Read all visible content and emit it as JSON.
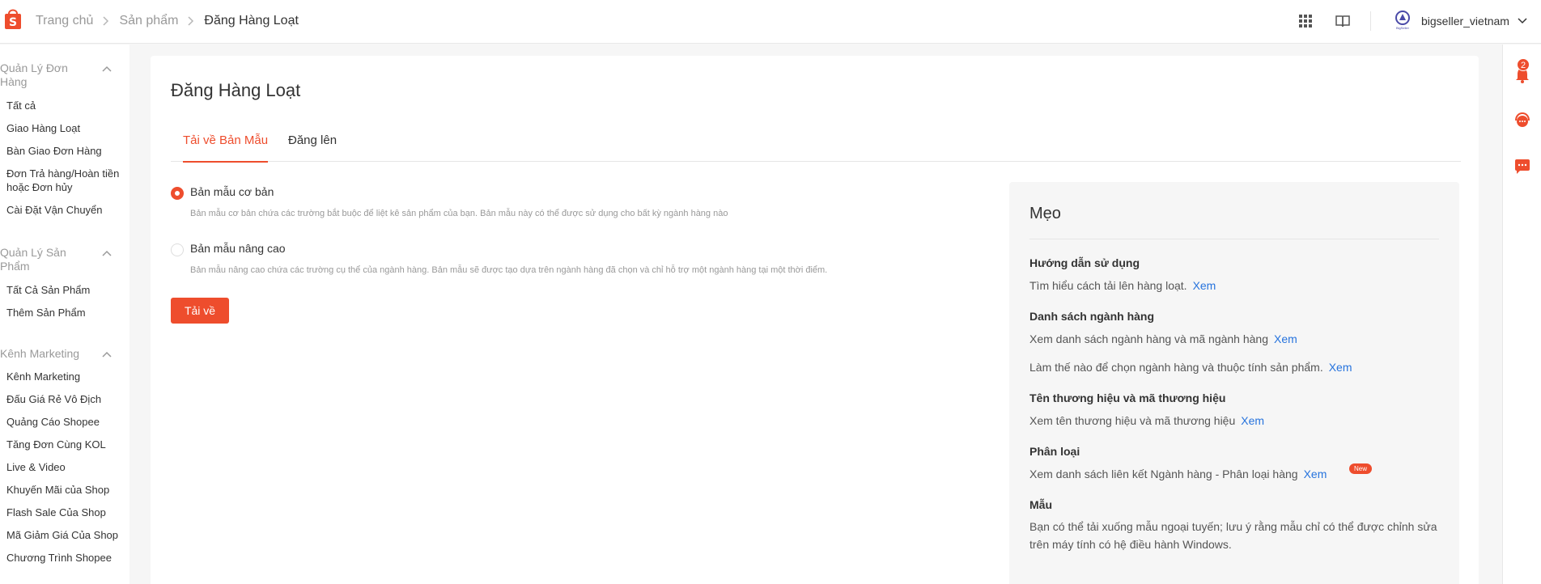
{
  "header": {
    "breadcrumb": [
      "Trang chủ",
      "Sản phẩm",
      "Đăng Hàng Loạt"
    ],
    "username": "bigseller_vietnam",
    "user_logo_caption": "BigSeller"
  },
  "sidebar": {
    "groups": [
      {
        "title": "Quản Lý Đơn Hàng",
        "items": [
          "Tất cả",
          "Giao Hàng Loạt",
          "Bàn Giao Đơn Hàng",
          "Đơn Trả hàng/Hoàn tiền hoặc Đơn hủy",
          "Cài Đặt Vận Chuyển"
        ]
      },
      {
        "title": "Quản Lý Sản Phẩm",
        "items": [
          "Tất Cả Sản Phẩm",
          "Thêm Sản Phẩm"
        ]
      },
      {
        "title": "Kênh Marketing",
        "items": [
          "Kênh Marketing",
          "Đấu Giá Rẻ Vô Địch",
          "Quảng Cáo Shopee",
          "Tăng Đơn Cùng KOL",
          "Live & Video",
          "Khuyến Mãi của Shop",
          "Flash Sale Của Shop",
          "Mã Giảm Giá Của Shop",
          "Chương Trình Shopee"
        ]
      }
    ]
  },
  "main": {
    "title": "Đăng Hàng Loạt",
    "tabs": [
      "Tải về Bản Mẫu",
      "Đăng lên"
    ],
    "options": [
      {
        "label": "Bản mẫu cơ bản",
        "desc": "Bản mẫu cơ bản chứa các trường bắt buộc để liệt kê sản phẩm của bạn. Bản mẫu này có thể được sử dụng cho bất kỳ ngành hàng nào",
        "selected": true
      },
      {
        "label": "Bản mẫu nâng cao",
        "desc": "Bản mẫu nâng cao chứa các trường cụ thể của ngành hàng. Bản mẫu sẽ được tạo dựa trên ngành hàng đã chọn và chỉ hỗ trợ một ngành hàng tại một thời điểm.",
        "selected": false
      }
    ],
    "download_button": "Tải về"
  },
  "tips": {
    "title": "Mẹo",
    "link": "Xem",
    "new_badge": "New",
    "s1": {
      "heading": "Hướng dẫn sử dụng",
      "text": "Tìm hiểu cách tải lên hàng loạt."
    },
    "s2": {
      "heading": "Danh sách ngành hàng",
      "text1": "Xem danh sách ngành hàng và mã ngành hàng",
      "text2": "Làm thế nào để chọn ngành hàng và thuộc tính sản phẩm."
    },
    "s3": {
      "heading": "Tên thương hiệu và mã thương hiệu",
      "text": "Xem tên thương hiệu và mã thương hiệu"
    },
    "s4": {
      "heading": "Phân loại",
      "text": "Xem danh sách liên kết Ngành hàng - Phân loại hàng"
    },
    "s5": {
      "heading": "Mẫu",
      "text": "Bạn có thể tải xuống mẫu ngoại tuyến; lưu ý rằng mẫu chỉ có thể được chỉnh sửa trên máy tính có hệ điều hành Windows."
    }
  },
  "rail": {
    "notification_count": "2"
  },
  "colors": {
    "brand": "#ee4d2d",
    "link": "#2673dd",
    "muted": "#999999"
  }
}
